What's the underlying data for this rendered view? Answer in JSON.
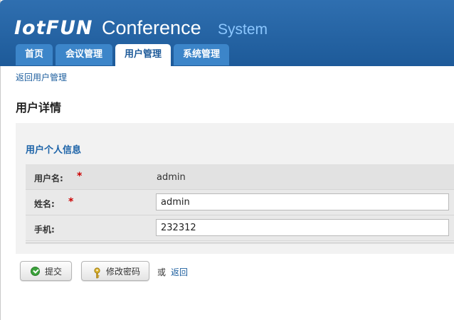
{
  "header": {
    "logo_text": "IotFUN",
    "title": "Conference",
    "subtitle": "System"
  },
  "nav": {
    "tabs": [
      {
        "label": "首页"
      },
      {
        "label": "会议管理"
      },
      {
        "label": "用户管理",
        "active": true
      },
      {
        "label": "系统管理"
      }
    ]
  },
  "content": {
    "back_link": "返回用户管理",
    "page_title": "用户详情",
    "section_title": "用户个人信息",
    "required_mark": "*",
    "fields": {
      "username": {
        "label": "用户名:",
        "value": "admin"
      },
      "name": {
        "label": "姓名:",
        "value": "admin"
      },
      "phone": {
        "label": "手机:",
        "value": "232312"
      }
    }
  },
  "actions": {
    "submit_label": "提交",
    "change_password_label": "修改密码",
    "or_text": "或",
    "return_label": "返回"
  },
  "colors": {
    "header_bg": "#1d5a99",
    "link": "#1c5e9e",
    "required": "#cc0000"
  }
}
